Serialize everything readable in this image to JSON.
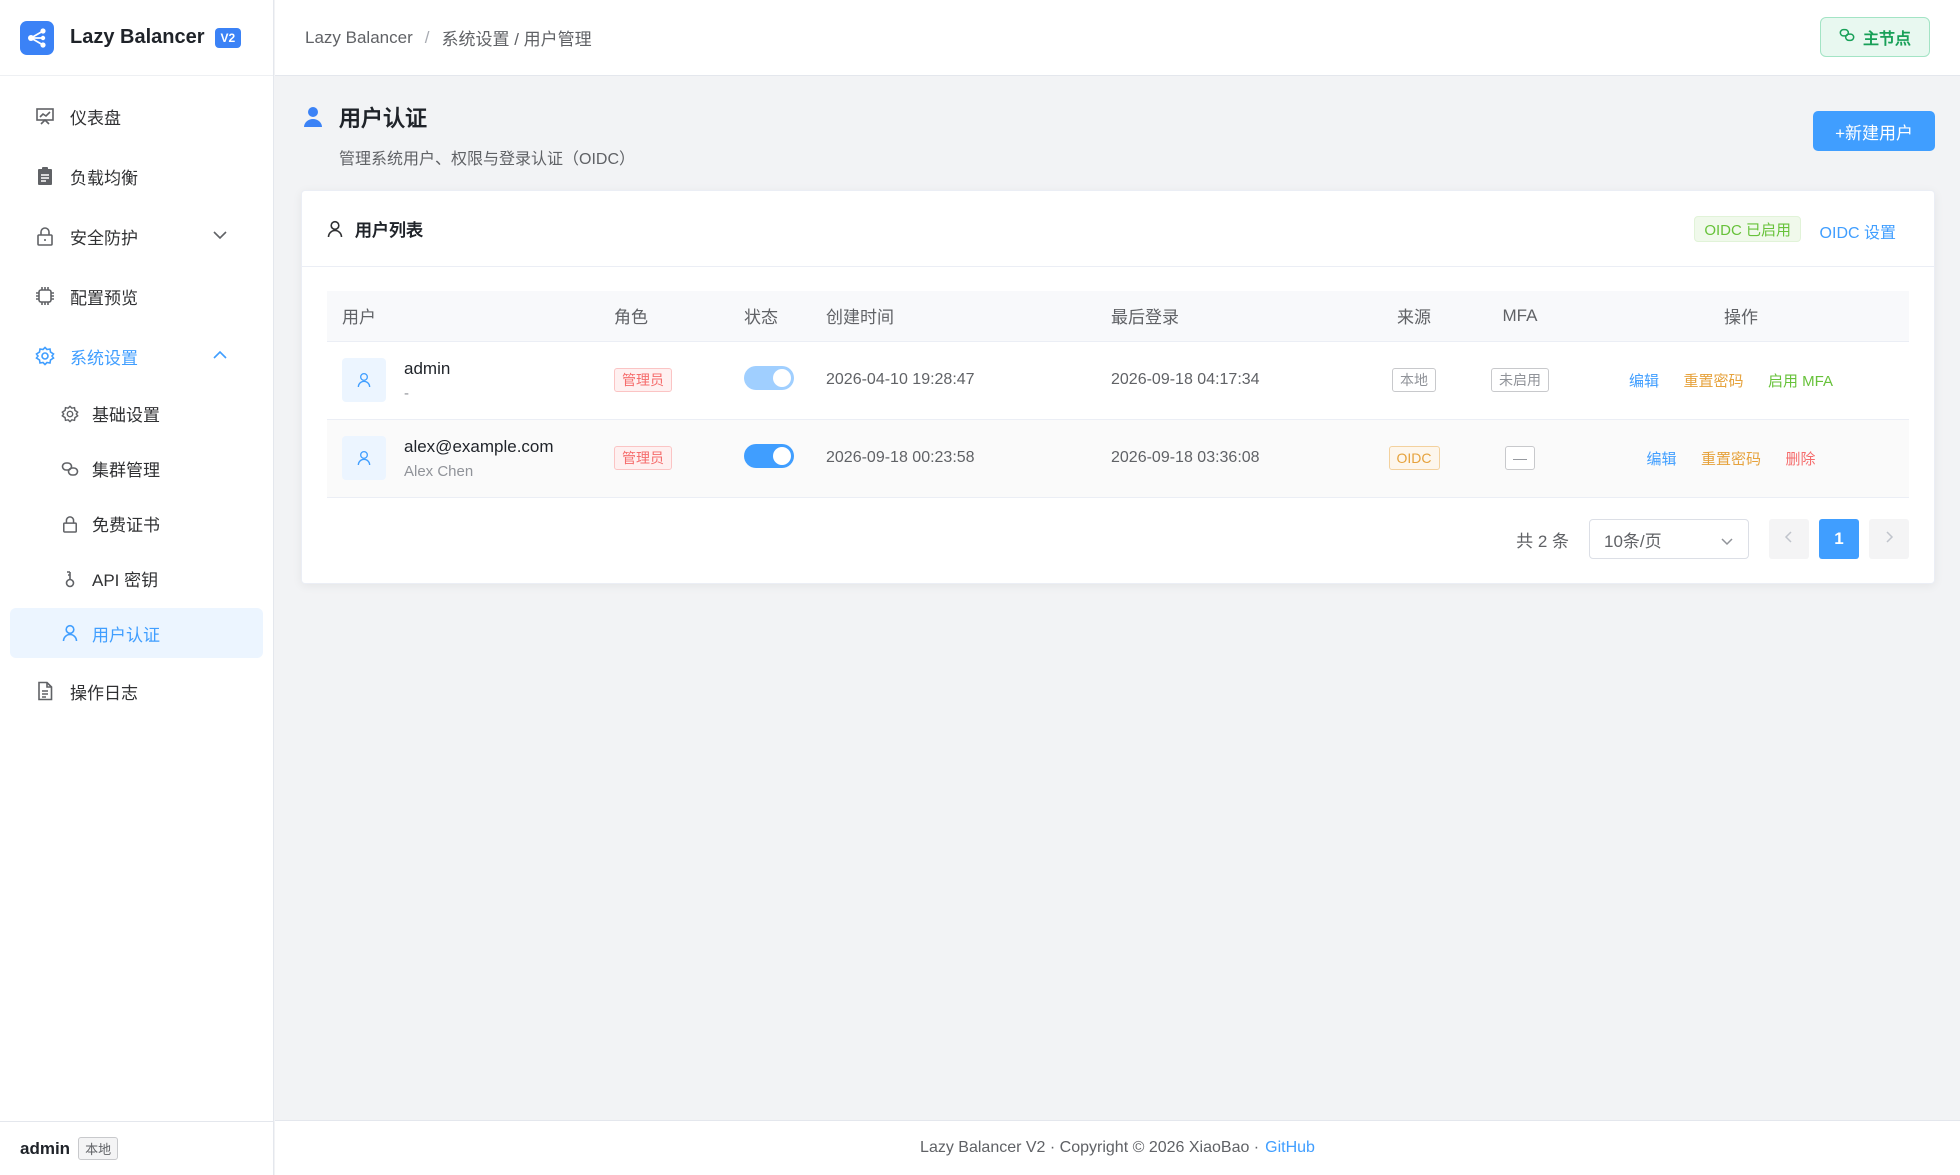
{
  "brand": {
    "name": "Lazy Balancer",
    "badge": "V2"
  },
  "sidebar": {
    "items": [
      {
        "label": "仪表盘",
        "icon": "dashboard-icon"
      },
      {
        "label": "负载均衡",
        "icon": "clipboard-icon"
      },
      {
        "label": "安全防护",
        "icon": "lock-icon"
      },
      {
        "label": "配置预览",
        "icon": "chip-icon"
      },
      {
        "label": "系统设置",
        "icon": "gear-icon"
      }
    ],
    "subitems": [
      {
        "label": "基础设置",
        "icon": "gear-icon"
      },
      {
        "label": "集群管理",
        "icon": "link-icon"
      },
      {
        "label": "免费证书",
        "icon": "lock-icon"
      },
      {
        "label": "API 密钥",
        "icon": "key-icon"
      },
      {
        "label": "用户认证",
        "icon": "user-icon"
      }
    ],
    "log_item": {
      "label": "操作日志",
      "icon": "document-icon"
    },
    "footer": {
      "user": "admin",
      "tag": "本地"
    }
  },
  "header": {
    "crumb_root": "Lazy Balancer",
    "crumb_sep": "/",
    "crumb_path": "系统设置 / 用户管理",
    "master_label": "主节点"
  },
  "page": {
    "title": "用户认证",
    "subtitle": "管理系统用户、权限与登录认证（OIDC）",
    "new_button": "+新建用户"
  },
  "card": {
    "title": "用户列表",
    "oidc_tag": "OIDC 已启用",
    "oidc_link": "OIDC 设置"
  },
  "table": {
    "headers": [
      "用户",
      "角色",
      "状态",
      "创建时间",
      "最后登录",
      "来源",
      "MFA",
      "操作"
    ],
    "rows": [
      {
        "name": "admin",
        "sub": "-",
        "role": "管理员",
        "enabled": true,
        "created": "2026-04-10 19:28:47",
        "last_login": "2026-09-18 04:17:34",
        "source": "本地",
        "mfa": "未启用",
        "actions": [
          "编辑",
          "重置密码",
          "启用 MFA"
        ]
      },
      {
        "name": "alex@example.com",
        "sub": "Alex Chen",
        "role": "管理员",
        "enabled": true,
        "created": "2026-09-18 00:23:58",
        "last_login": "2026-09-18 03:36:08",
        "source": "OIDC",
        "mfa": "—",
        "actions": [
          "编辑",
          "重置密码",
          "删除"
        ]
      }
    ]
  },
  "pagination": {
    "total": "共 2 条",
    "page_size": "10条/页",
    "current": "1"
  },
  "footer": {
    "text": "Lazy Balancer V2 · Copyright © 2026 XiaoBao ·",
    "link": "GitHub"
  },
  "colors": {
    "primary": "#409eff",
    "success": "#67c23a",
    "warning": "#e6a23c",
    "danger": "#f56c6c"
  }
}
